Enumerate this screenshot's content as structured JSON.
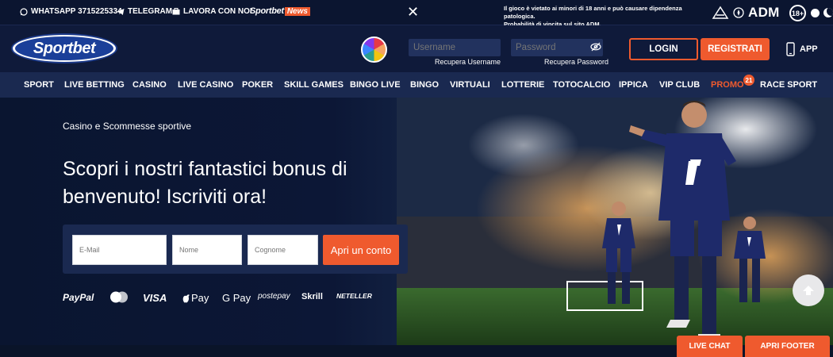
{
  "topbar": {
    "whatsapp": "WHATSAPP 3715225334",
    "telegram": "TELEGRAM",
    "jobs": "LAVORA CON NOI",
    "news_logo_a": "Sportbet",
    "news_logo_b": "News",
    "close": "✕",
    "warning_line1": "Il gioco è vietato ai minori di 18 anni e può causare dipendenza patologica.",
    "warning_line2": "Probabilità di vincita sul sito ADM.",
    "adm": "ADM",
    "age": "18+"
  },
  "header": {
    "logo": "Sportbet",
    "username_placeholder": "Username",
    "password_placeholder": "Password",
    "recover_username": "Recupera Username",
    "recover_password": "Recupera Password",
    "login": "LOGIN",
    "register": "REGISTRATI",
    "app": "APP"
  },
  "nav": {
    "items": [
      "SPORT",
      "LIVE BETTING",
      "CASINO",
      "LIVE CASINO",
      "POKER",
      "SKILL GAMES",
      "BINGO LIVE",
      "BINGO",
      "VIRTUALI",
      "LOTTERIE",
      "TOTOCALCIO",
      "IPPICA",
      "VIP CLUB",
      "PROMO",
      "RACE SPORT"
    ],
    "promo_badge": "21"
  },
  "hero": {
    "subtitle": "Casino e Scommesse sportive",
    "title": "Scopri i nostri fantastici bonus di benvenuto! Iscriviti ora!",
    "email_placeholder": "E-Mail",
    "name_placeholder": "Nome",
    "surname_placeholder": "Cognome",
    "open_account": "Apri un conto",
    "payments": [
      "PayPal",
      "Mastercard",
      "VISA",
      "Apple Pay",
      "G Pay",
      "postepay",
      "Skrill",
      "NETELLER"
    ],
    "apple_pay_text": "Pay",
    "gpay_text": "G Pay"
  },
  "footer": {
    "live_chat": "LIVE CHAT",
    "open_footer": "APRI FOOTER"
  },
  "colors": {
    "accent": "#ef5a2e",
    "navy": "#0d1733",
    "nav_bg": "#1a2950"
  }
}
